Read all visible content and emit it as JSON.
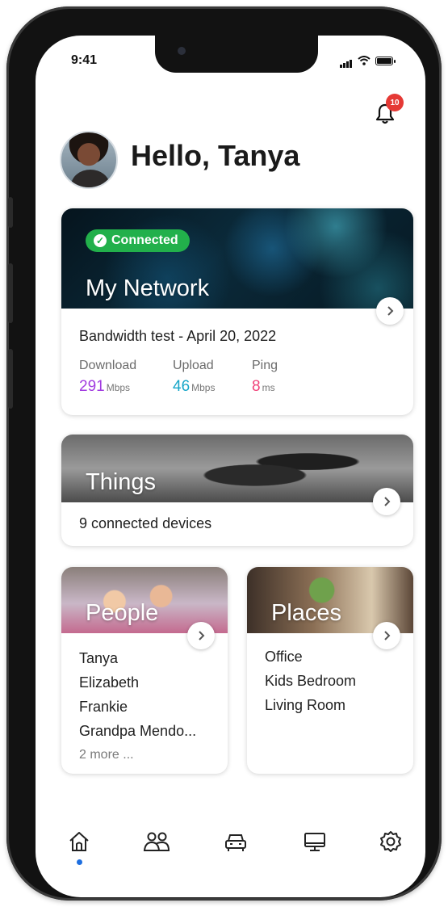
{
  "status_bar": {
    "time": "9:41"
  },
  "notifications": {
    "count": "10"
  },
  "greeting": "Hello, Tanya",
  "network_card": {
    "status": "Connected",
    "title": "My Network",
    "bandwidth_title": "Bandwidth test - April 20, 2022",
    "metrics": [
      {
        "label": "Download",
        "value": "291",
        "unit": "Mbps",
        "color": "#a23ce0"
      },
      {
        "label": "Upload",
        "value": "46",
        "unit": "Mbps",
        "color": "#17a6c8"
      },
      {
        "label": "Ping",
        "value": "8",
        "unit": "ms",
        "color": "#f0437a"
      }
    ]
  },
  "things_card": {
    "title": "Things",
    "subtitle": "9 connected devices"
  },
  "people_card": {
    "title": "People",
    "items": [
      "Tanya",
      "Elizabeth",
      "Frankie",
      "Grandpa Mendo..."
    ],
    "more": "2 more ..."
  },
  "places_card": {
    "title": "Places",
    "items": [
      "Office",
      "Kids Bedroom",
      "Living Room"
    ]
  },
  "tabbar": {
    "active": "home",
    "tabs": [
      "home-icon",
      "people-icon",
      "car-icon",
      "monitor-icon",
      "settings-icon"
    ]
  },
  "colors": {
    "connected": "#22b04b",
    "badge": "#e53935",
    "active_tab": "#1e6fe0"
  }
}
